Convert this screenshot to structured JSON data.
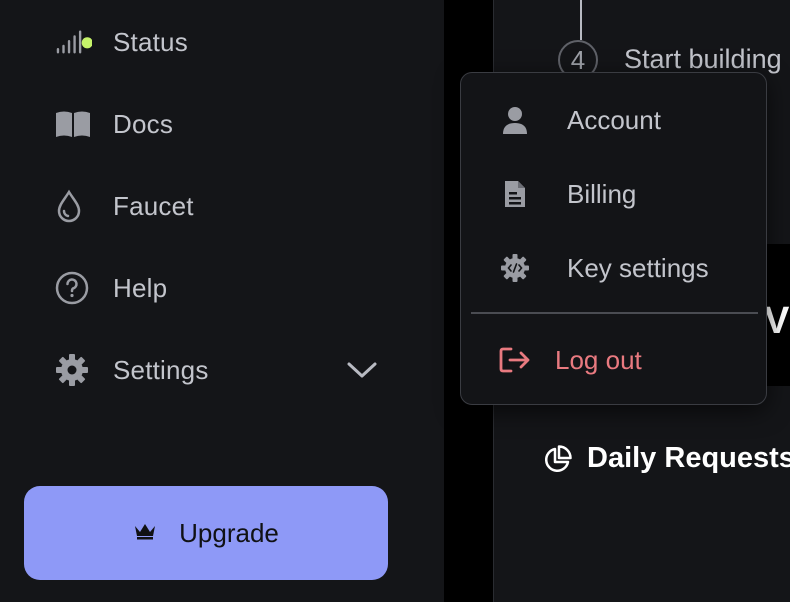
{
  "sidebar": {
    "items": [
      {
        "label": "Status",
        "icon": "signal-status-icon"
      },
      {
        "label": "Docs",
        "icon": "book-icon"
      },
      {
        "label": "Faucet",
        "icon": "droplet-icon"
      },
      {
        "label": "Help",
        "icon": "help-circle-icon"
      },
      {
        "label": "Settings",
        "icon": "gear-icon"
      }
    ],
    "upgrade_label": "Upgrade"
  },
  "main": {
    "step_number": "4",
    "step_label": "Start building",
    "card_text": "V",
    "daily_label": "Daily Requests"
  },
  "menu": {
    "items": [
      {
        "label": "Account",
        "icon": "user-icon"
      },
      {
        "label": "Billing",
        "icon": "document-icon"
      },
      {
        "label": "Key settings",
        "icon": "code-gear-icon"
      }
    ],
    "logout_label": "Log out"
  },
  "colors": {
    "background": "#141518",
    "accent": "#8e99f7",
    "status_dot": "#c6f36a",
    "logout": "#e97a80"
  }
}
